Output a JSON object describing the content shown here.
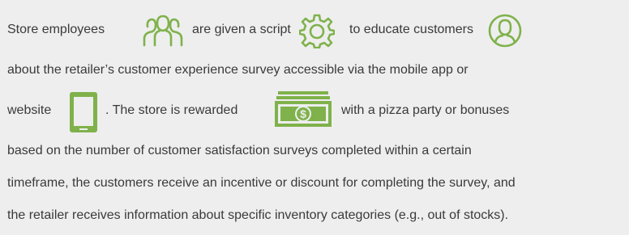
{
  "accent_color": "#7fb24b",
  "text_color": "#3a3a3a",
  "background_color": "#eeeeee",
  "paragraph": {
    "line1": {
      "seg1": "Store employees",
      "icon1": "employees-group-icon",
      "seg2": "are given a script",
      "icon2": "gear-icon",
      "seg3": "to educate customers",
      "icon3": "customer-person-icon"
    },
    "line2": "about the retailer’s customer experience survey accessible via the mobile app or",
    "line3": {
      "seg1": "website",
      "icon1": "tablet-device-icon",
      "seg2": ". The store is rewarded",
      "icon2": "money-stack-icon",
      "seg3": "with a pizza party or bonuses"
    },
    "line4": "based on the number of customer satisfaction surveys completed within a certain",
    "line5": "timeframe, the customers receive an incentive or discount for completing the survey, and",
    "line6": "the retailer receives information about specific inventory categories (e.g., out of stocks)."
  }
}
